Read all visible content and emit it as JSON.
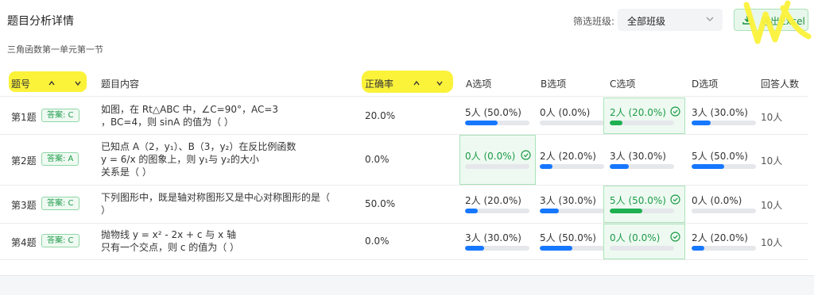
{
  "header": {
    "title": "题目分析详情",
    "subtitle": "三角函数第一单元第一节",
    "filter_label": "筛选班级:",
    "filter_value": "全部班级",
    "export_label": "导出Excel"
  },
  "table": {
    "columns": [
      "题号",
      "题目内容",
      "正确率",
      "A选项",
      "B选项",
      "C选项",
      "D选项",
      "回答人数"
    ],
    "rows": [
      {
        "num": "第1题",
        "answer": "答案: C",
        "content": [
          "如图，在 Rt△ABC 中，∠C=90°，AC=3",
          "，BC=4，则 sinA 的值为（ ）"
        ],
        "rate": "20.0%",
        "options": [
          {
            "text": "5人 (50.0%)",
            "fill": 0.5,
            "correct": false
          },
          {
            "text": "0人 (0.0%)",
            "fill": 0.0,
            "correct": false
          },
          {
            "text": "2人 (20.0%)",
            "fill": 0.2,
            "correct": true
          },
          {
            "text": "3人 (30.0%)",
            "fill": 0.3,
            "correct": false
          }
        ],
        "count": "10人"
      },
      {
        "num": "第2题",
        "answer": "答案: A",
        "content": [
          "已知点 A（2，y₁）、B（3，y₂）在反比例函数",
          " y = 6/x 的图象上，则 y₁与 y₂的大小",
          " 关系是（ ）"
        ],
        "rate": "0.0%",
        "options": [
          {
            "text": "0人 (0.0%)",
            "fill": 0.0,
            "correct": true
          },
          {
            "text": "2人 (20.0%)",
            "fill": 0.2,
            "correct": false
          },
          {
            "text": "3人 (30.0%)",
            "fill": 0.3,
            "correct": false
          },
          {
            "text": "5人 (50.0%)",
            "fill": 0.5,
            "correct": false
          }
        ],
        "count": "10人"
      },
      {
        "num": "第3题",
        "answer": "答案: C",
        "content": [
          "下列图形中，既是轴对称图形又是中心对称图形的是（",
          "）"
        ],
        "rate": "50.0%",
        "options": [
          {
            "text": "2人 (20.0%)",
            "fill": 0.2,
            "correct": false
          },
          {
            "text": "3人 (30.0%)",
            "fill": 0.3,
            "correct": false
          },
          {
            "text": "5人 (50.0%)",
            "fill": 0.5,
            "correct": true
          },
          {
            "text": "0人 (0.0%)",
            "fill": 0.0,
            "correct": false
          }
        ],
        "count": "10人"
      },
      {
        "num": "第4题",
        "answer": "答案: C",
        "content": [
          "抛物线 y = x² - 2x + c 与 x 轴",
          "只有一个交点，则 c 的值为（ ）"
        ],
        "rate": "0.0%",
        "options": [
          {
            "text": "3人 (30.0%)",
            "fill": 0.3,
            "correct": false
          },
          {
            "text": "5人 (50.0%)",
            "fill": 0.5,
            "correct": false
          },
          {
            "text": "0人 (0.0%)",
            "fill": 0.0,
            "correct": true
          },
          {
            "text": "2人 (20.0%)",
            "fill": 0.2,
            "correct": false
          }
        ],
        "count": "10人"
      }
    ]
  },
  "icons": {
    "sort_up": "chevron-up-icon",
    "sort_down": "chevron-down-icon",
    "download": "download-icon",
    "check": "check-circle-icon"
  },
  "colors": {
    "accent_green": "#1e9b4a",
    "bar_blue": "#1677ff",
    "bar_green": "#1fb052",
    "highlight_yellow": "#fbf23a"
  }
}
